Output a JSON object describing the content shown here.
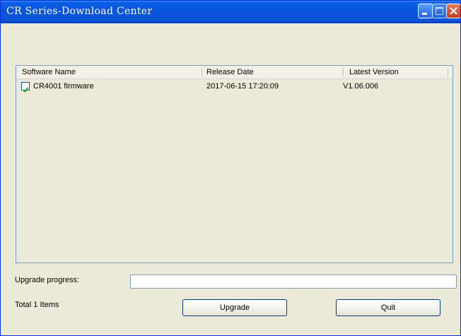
{
  "window": {
    "title": "CR Series-Download Center"
  },
  "list": {
    "columns": [
      "Software Name",
      "Release Date",
      "Latest Version"
    ],
    "rows": [
      {
        "name": "CR4001 firmware",
        "date": "2017-06-15 17:20:09",
        "version": "V1.06.006",
        "checked": true
      }
    ]
  },
  "progress": {
    "label": "Upgrade progress:",
    "fraction": 0
  },
  "footer": {
    "total": "Total 1 Items",
    "upgrade_label": "Upgrade",
    "quit_label": "Quit"
  },
  "colors": {
    "titlebar": "#0a54d6",
    "window_bg": "#ece9d8",
    "border": "#7f9db9"
  },
  "icons": [
    "minimize-icon",
    "maximize-icon",
    "close-icon",
    "checkmark-icon"
  ]
}
